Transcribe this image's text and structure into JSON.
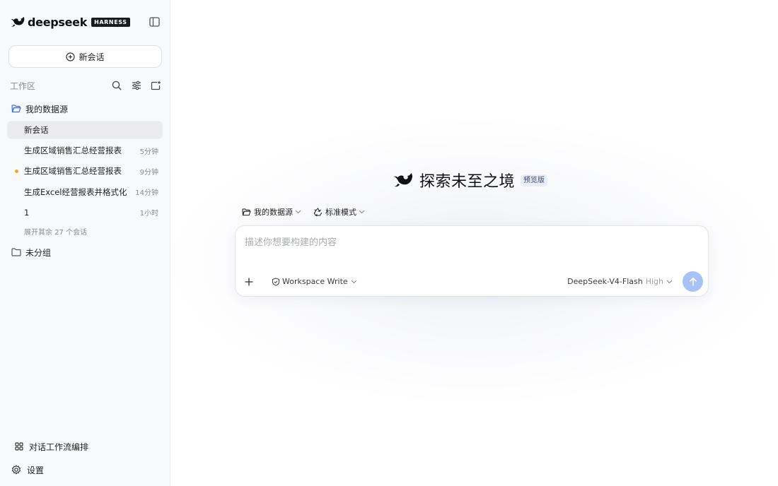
{
  "brand": {
    "name": "deepseek",
    "tag": "HARNESS"
  },
  "sidebar": {
    "new_chat_label": "新会话",
    "workspace_label": "工作区",
    "folder_mine": "我的数据源",
    "chats": [
      {
        "title": "新会话",
        "time": "",
        "active": true,
        "unread": false
      },
      {
        "title": "生成区域销售汇总经营报表",
        "time": "5分钟",
        "active": false,
        "unread": false
      },
      {
        "title": "生成区域销售汇总经营报表",
        "time": "9分钟",
        "active": false,
        "unread": true
      },
      {
        "title": "生成Excel经营报表并格式化",
        "time": "14分钟",
        "active": false,
        "unread": false
      },
      {
        "title": "1",
        "time": "1小时",
        "active": false,
        "unread": false
      }
    ],
    "expand_more": "展开其余 27 个会话",
    "folder_ungrouped": "未分组",
    "workflow_label": "对话工作流编排",
    "settings_label": "设置"
  },
  "main": {
    "hero_title": "探索未至之境",
    "preview_badge": "预览版",
    "datasource_label": "我的数据源",
    "mode_label": "标准模式",
    "prompt_placeholder": "描述你想要构建的内容",
    "permission_label": "Workspace Write",
    "model_label": "DeepSeek-V4-Flash",
    "effort_label": "High"
  },
  "colors": {
    "accent": "#a9c2f5",
    "folder_blue": "#3b6fd8",
    "unread_dot": "#f5a524"
  }
}
